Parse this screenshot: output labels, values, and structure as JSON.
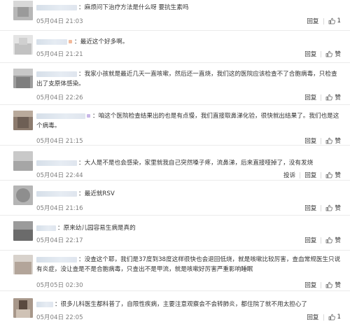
{
  "comments": [
    {
      "prefix": "：",
      "text": "麻烦问下治疗方法是什么呀 要抗生素吗",
      "time": "05月04日 21:03",
      "actions": [
        "回复"
      ],
      "likes": "1"
    },
    {
      "prefix": "：",
      "text": "最近这个好多啊。",
      "time": "05月04日 21:21",
      "actions": [
        "回复"
      ],
      "likes": "赞"
    },
    {
      "prefix": "：",
      "text": "我家小孩就是最近几天一直咳嗽，然后还一直烧，我们这的医院应该检查不了合胞病毒，只检查出了支原体感染。",
      "time": "05月04日 22:26",
      "actions": [
        "回复"
      ],
      "likes": "赞"
    },
    {
      "prefix": "：",
      "text": "咱这个医院检查结果出的也是有点慢，我们直接取鼻涕化验，很快就出结果了。我们也是这个病毒。",
      "time": "05月04日 21:15",
      "actions": [
        "回复"
      ],
      "likes": "赞"
    },
    {
      "prefix": "：",
      "text": "大人是不是也会感染，家里就我自己突然嗓子疼，流鼻涕，后来直接哑掉了，没有发烧",
      "time": "05月04日 22:44",
      "actions": [
        "投诉",
        "回复"
      ],
      "likes": "赞"
    },
    {
      "prefix": "：",
      "text": "最近就RSV",
      "time": "05月04日 21:16",
      "actions": [
        "回复"
      ],
      "likes": "赞"
    },
    {
      "prefix": "：",
      "text": "原来幼儿园容易生病是真的",
      "time": "05月04日 22:17",
      "actions": [
        "回复"
      ],
      "likes": "赞"
    },
    {
      "prefix": "：",
      "text": "没查这个耶，我们是37度到38度这样很快也会退回低烧，就是咳嗽比较厉害，查血常规医生只说有炎症，没让查是不是合胞病毒，只查出不是甲流，就是咳嗽好厉害严重影响睡眠",
      "time": "05月05日 02:30",
      "actions": [
        "回复"
      ],
      "likes": "赞"
    },
    {
      "prefix": "：",
      "text": "很多儿科医生都科普了，自限性疾病，主要注意观察会不会转肺炎，都住院了就不用太担心了",
      "time": "05月04日 22:05",
      "actions": [
        "回复"
      ],
      "likes": "1"
    }
  ],
  "thumb_icon": "thumbs-up-icon",
  "colors": {
    "link": "#eb7350",
    "meta": "#808080",
    "divider": "#ebebeb"
  }
}
